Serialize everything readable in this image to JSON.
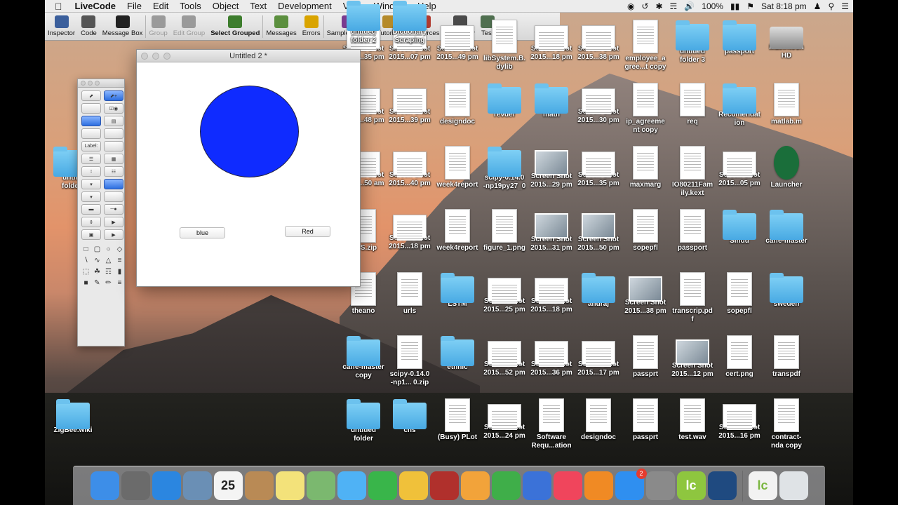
{
  "menubar": {
    "apple_icon": "apple-icon",
    "app": "LiveCode",
    "items": [
      "File",
      "Edit",
      "Tools",
      "Object",
      "Text",
      "Development",
      "View",
      "Window",
      "Help"
    ],
    "battery": "100%",
    "clock": "Sat 8:18 pm"
  },
  "toolbar": {
    "items": [
      {
        "label": "Inspector",
        "icon": "inspector-icon",
        "color": "#3b5f9c"
      },
      {
        "label": "Code",
        "icon": "code-icon",
        "color": "#555555"
      },
      {
        "label": "Message Box",
        "icon": "message-box-icon",
        "color": "#222222"
      },
      {
        "label": "Group",
        "icon": "group-icon",
        "color": "#9a9a9a"
      },
      {
        "label": "Edit Group",
        "icon": "edit-group-icon",
        "color": "#9a9a9a"
      },
      {
        "label": "Select Grouped",
        "icon": "select-grouped-icon",
        "color": "#3d7d2d"
      },
      {
        "label": "Messages",
        "icon": "messages-icon",
        "color": "#5b8f3e"
      },
      {
        "label": "Errors",
        "icon": "errors-icon",
        "color": "#d9a400"
      },
      {
        "label": "Sample Stacks",
        "icon": "sample-stacks-icon",
        "color": "#7a3b8f"
      },
      {
        "label": "Tutorials",
        "icon": "tutorials-icon",
        "color": "#b58a2a"
      },
      {
        "label": "Resources",
        "icon": "resources-icon",
        "color": "#b03a2e"
      },
      {
        "label": "Dictionary",
        "icon": "dictionary-icon",
        "color": "#4a4a4a"
      },
      {
        "label": "Test",
        "icon": "test-icon",
        "color": "#4f6f4f"
      }
    ]
  },
  "stack_window": {
    "title": "Untitled 2 *",
    "circle_color": "#0f2bff",
    "blue_button": "blue",
    "red_button": "Red"
  },
  "tools_palette": {
    "label_field": "Label:"
  },
  "desktop": {
    "left_icons": [
      {
        "label": "untit\nfolde",
        "kind": "folder"
      },
      {
        "label": "ZigBee.wiki",
        "kind": "folder"
      }
    ],
    "icons": [
      {
        "label": "Screen Shot\n2015...35 pm",
        "kind": "shot"
      },
      {
        "label": "Screen Shot\n2015...07 pm",
        "kind": "shot"
      },
      {
        "label": "Screen Shot\n2015...49 pm",
        "kind": "shot"
      },
      {
        "label": "libSystem.B.\ndylib",
        "kind": "doc"
      },
      {
        "label": "Screen Shot\n2015...18 pm",
        "kind": "shot"
      },
      {
        "label": "Screen Shot\n2015...38 pm",
        "kind": "shot"
      },
      {
        "label": "employee_a\ngree...t copy",
        "kind": "doc"
      },
      {
        "label": "untitled\nfolder 3",
        "kind": "folder"
      },
      {
        "label": "passport",
        "kind": "folder"
      },
      {
        "label": "Macintosh\nHD",
        "kind": "hd"
      },
      {
        "label": "Screen Shot\n2015...48 pm",
        "kind": "shot"
      },
      {
        "label": "Screen Shot\n2015...39 pm",
        "kind": "shot"
      },
      {
        "label": "designdoc",
        "kind": "doc"
      },
      {
        "label": "revdef",
        "kind": "folder"
      },
      {
        "label": "math",
        "kind": "folder"
      },
      {
        "label": "Screen Shot\n2015...30 pm",
        "kind": "shot"
      },
      {
        "label": "ip_agreeme\nnt copy",
        "kind": "doc"
      },
      {
        "label": "req",
        "kind": "doc"
      },
      {
        "label": "Recomendat\nion",
        "kind": "folder"
      },
      {
        "label": "matlab.m",
        "kind": "doc"
      },
      {
        "label": "Screen Shot\n2015...50 am",
        "kind": "shot"
      },
      {
        "label": "Screen Shot\n2015...40 pm",
        "kind": "shot"
      },
      {
        "label": "week4report",
        "kind": "doc"
      },
      {
        "label": "scipy-0.14.0\n-np19py27_0",
        "kind": "folder"
      },
      {
        "label": "Screen Shot\n2015...29 pm",
        "kind": "photo"
      },
      {
        "label": "Screen Shot\n2015...35 pm",
        "kind": "shot"
      },
      {
        "label": "maxmarg",
        "kind": "doc"
      },
      {
        "label": "IO80211Fam\nily.kext",
        "kind": "doc"
      },
      {
        "label": "Screen Shot\n2015...05 pm",
        "kind": "shot"
      },
      {
        "label": "Launcher",
        "kind": "app"
      },
      {
        "label": "KGS.zip",
        "kind": "doc"
      },
      {
        "label": "Screen Shot\n2015...18 pm",
        "kind": "shot"
      },
      {
        "label": "week4report",
        "kind": "doc"
      },
      {
        "label": "figure_1.png",
        "kind": "doc"
      },
      {
        "label": "Screen Shot\n2015...31 pm",
        "kind": "photo"
      },
      {
        "label": "Screen Shot\n2015...50 pm",
        "kind": "photo"
      },
      {
        "label": "sopepfl",
        "kind": "doc"
      },
      {
        "label": "passport",
        "kind": "doc"
      },
      {
        "label": "Sindu",
        "kind": "folder"
      },
      {
        "label": "caffe-master",
        "kind": "folder"
      },
      {
        "label": "theano",
        "kind": "doc"
      },
      {
        "label": "urls",
        "kind": "doc"
      },
      {
        "label": "LSTM",
        "kind": "folder"
      },
      {
        "label": "Screen Shot\n2015...25 pm",
        "kind": "shot"
      },
      {
        "label": "Screen Shot\n2015...18 pm",
        "kind": "shot"
      },
      {
        "label": "anuraj",
        "kind": "folder"
      },
      {
        "label": "Screen Shot\n2015...38 pm",
        "kind": "photo"
      },
      {
        "label": "transcrip.pd\nf",
        "kind": "doc"
      },
      {
        "label": "sopepfl",
        "kind": "doc"
      },
      {
        "label": "sweden",
        "kind": "folder"
      },
      {
        "label": "caffe-master\ncopy",
        "kind": "folder"
      },
      {
        "label": "scipy-0.14.0\n-np1...  0.zip",
        "kind": "doc"
      },
      {
        "label": "ethnic",
        "kind": "folder"
      },
      {
        "label": "Screen Shot\n2015...52 pm",
        "kind": "shot"
      },
      {
        "label": "Screen Shot\n2015...36 pm",
        "kind": "shot"
      },
      {
        "label": "Screen Shot\n2015...17 pm",
        "kind": "shot"
      },
      {
        "label": "passprt",
        "kind": "doc"
      },
      {
        "label": "Screen Shot\n2015...12 pm",
        "kind": "photo"
      },
      {
        "label": "cert.png",
        "kind": "doc"
      },
      {
        "label": "transpdf",
        "kind": "doc"
      },
      {
        "label": "untitled\nfolder",
        "kind": "folder"
      },
      {
        "label": "cns",
        "kind": "folder"
      },
      {
        "label": "(Busy) PLot",
        "kind": "doc"
      },
      {
        "label": "Screen Shot\n2015...24 pm",
        "kind": "shot"
      },
      {
        "label": "Software\nRequ...ation",
        "kind": "doc"
      },
      {
        "label": "designdoc",
        "kind": "doc"
      },
      {
        "label": "passprt",
        "kind": "doc"
      },
      {
        "label": "test.wav",
        "kind": "doc"
      },
      {
        "label": "Screen Shot\n2015...16 pm",
        "kind": "shot"
      },
      {
        "label": "contract-\nnda copy",
        "kind": "doc"
      },
      {
        "label": "untitled\nfolder 2",
        "kind": "folder"
      },
      {
        "label": "Dictionary\nScraping",
        "kind": "folder"
      }
    ]
  },
  "dock": {
    "items": [
      {
        "name": "finder-icon",
        "color": "#3d8ee8"
      },
      {
        "name": "launchpad-icon",
        "color": "#6b6b6b"
      },
      {
        "name": "safari-icon",
        "color": "#2b86e0"
      },
      {
        "name": "preview-icon",
        "color": "#6a8fb5"
      },
      {
        "name": "calendar-icon",
        "color": "#f4f4f4",
        "text": "25"
      },
      {
        "name": "contacts-icon",
        "color": "#b98a55"
      },
      {
        "name": "notes-icon",
        "color": "#f3e27a"
      },
      {
        "name": "maps-icon",
        "color": "#7bb86f"
      },
      {
        "name": "messages-icon",
        "color": "#4fb2f5"
      },
      {
        "name": "facetime-icon",
        "color": "#39b54a"
      },
      {
        "name": "photos-icon",
        "color": "#f0c13a"
      },
      {
        "name": "photo-booth-icon",
        "color": "#b0302c"
      },
      {
        "name": "pages-icon",
        "color": "#f2a33a"
      },
      {
        "name": "numbers-icon",
        "color": "#3fae49"
      },
      {
        "name": "keynote-icon",
        "color": "#3b72d8"
      },
      {
        "name": "itunes-icon",
        "color": "#f0455c"
      },
      {
        "name": "ibooks-icon",
        "color": "#f08a24"
      },
      {
        "name": "app-store-icon",
        "color": "#2f8ff0",
        "badge": "2"
      },
      {
        "name": "system-preferences-icon",
        "color": "#8a8a8a"
      },
      {
        "name": "livecode-icon",
        "color": "#8ec63f",
        "text": "lc"
      },
      {
        "name": "quicktime-icon",
        "color": "#1f4a80"
      },
      {
        "name": "livecode-document-icon",
        "color": "#f2f2f2",
        "text": "lc"
      },
      {
        "name": "trash-icon",
        "color": "#dfe3e6"
      }
    ]
  }
}
